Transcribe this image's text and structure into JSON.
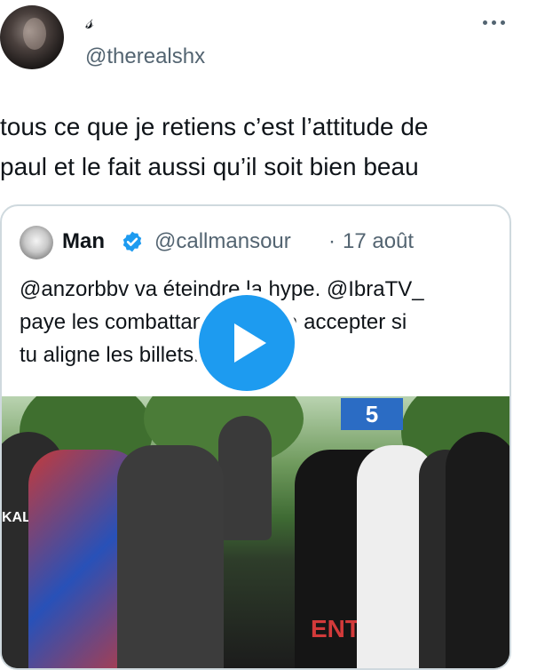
{
  "author": {
    "display_name": "𝓈",
    "handle": "@therealshx"
  },
  "tweet": {
    "text": "tous ce que je retiens c’est l’attitude de\npaul et le fait aussi qu’il soit bien beau"
  },
  "quoted_tweet": {
    "name": "Man",
    "handle": "@callmansour",
    "separator": "·",
    "date": "17 août",
    "text": "@anzorbbv va éteindre la hype. @IbraTV_\npaye les combattants Paul va accepter si\ntu aligne les billets.",
    "media": {
      "sign_text": "5",
      "shirt_text": "KALOS",
      "shirt_text_2": "ENT"
    }
  },
  "icons": {
    "more": "more-horizontal-icon",
    "verified": "verified-badge-icon",
    "play": "play-icon"
  },
  "colors": {
    "text_primary": "#0f1419",
    "text_secondary": "#536471",
    "accent": "#1d9bf0",
    "border": "#cfd9de"
  }
}
